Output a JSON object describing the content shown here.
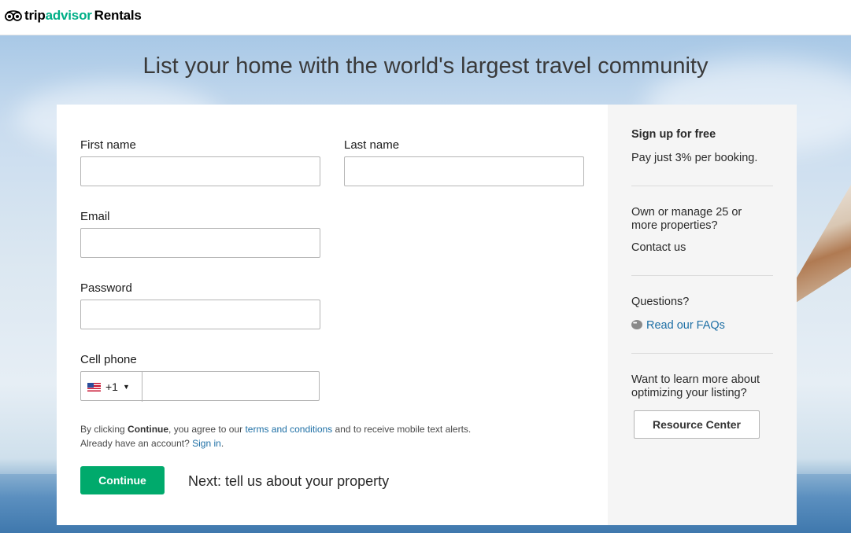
{
  "brand": {
    "prefix": "trip",
    "highlight": "advisor",
    "suffix": "Rentals"
  },
  "headline": "List your home with the world's largest travel community",
  "form": {
    "first_name_label": "First name",
    "last_name_label": "Last name",
    "email_label": "Email",
    "password_label": "Password",
    "phone_label": "Cell phone",
    "country_code": "+1",
    "legal_prefix": "By clicking ",
    "legal_bold": "Continue",
    "legal_mid": ", you agree to our ",
    "legal_link": "terms and conditions",
    "legal_suffix": " and to receive mobile text alerts.",
    "account_prompt": "Already have an account? ",
    "sign_in_link": "Sign in",
    "sign_in_period": ".",
    "continue_label": "Continue",
    "next_text": "Next: tell us about your property"
  },
  "sidebar": {
    "signup_title": "Sign up for free",
    "signup_text": "Pay just 3% per booking.",
    "manage_text": "Own or manage 25 or more properties?",
    "contact_link": "Contact us",
    "questions_text": "Questions?",
    "faq_link": "Read our FAQs",
    "learn_text": "Want to learn more about optimizing your listing?",
    "resource_button": "Resource Center"
  },
  "colors": {
    "accent": "#00aa6c",
    "link": "#1d6fa5"
  }
}
